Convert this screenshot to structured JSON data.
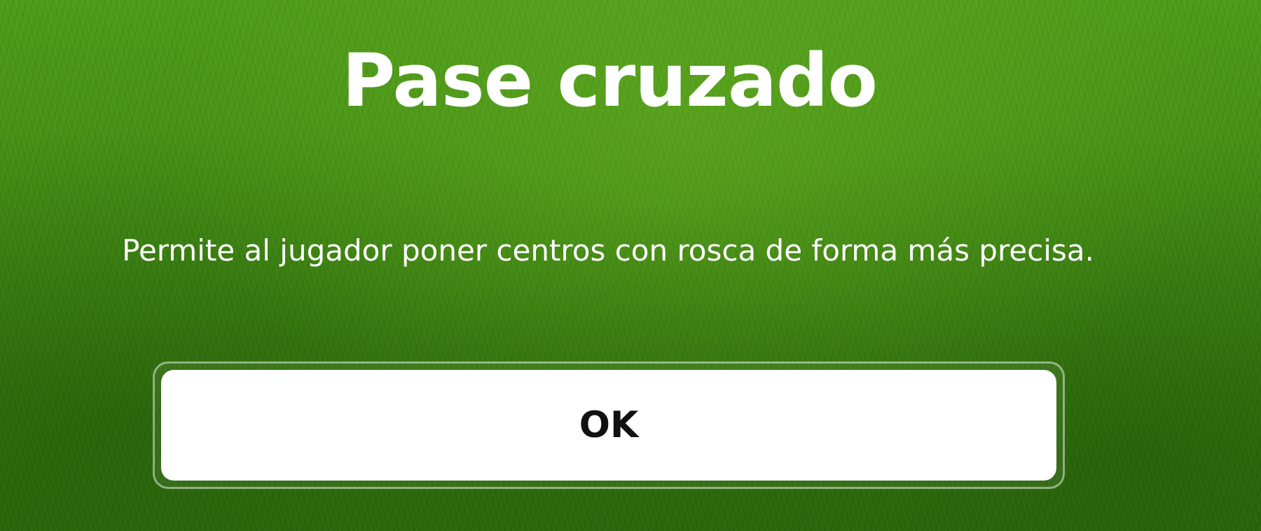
{
  "dialog": {
    "title": "Pase cruzado",
    "description": "Permite al jugador poner centros con rosca de forma más precisa.",
    "ok_label": "OK"
  },
  "colors": {
    "background": "#3f8a12",
    "text": "#ffffff",
    "button_background": "#ffffff",
    "button_text": "#111111"
  }
}
